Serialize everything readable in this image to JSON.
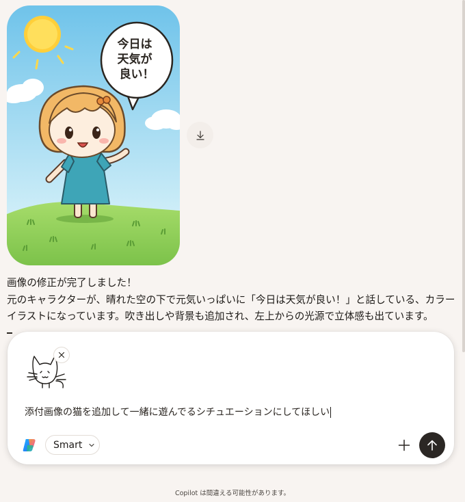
{
  "image": {
    "speech_bubble_lines": [
      "今日は",
      "天気が",
      "良い！"
    ],
    "alt": "晴れた空の下で元気いっぱいのキャラクター"
  },
  "icons": {
    "download": "download-icon",
    "close": "close-icon",
    "chevron": "chevron-down-icon",
    "plus": "plus-icon",
    "send": "arrow-up-icon",
    "logo": "copilot-logo-icon"
  },
  "reply": {
    "line1": "画像の修正が完了しました！",
    "line2": "元のキャラクターが、晴れた空の下で元気いっぱいに「今日は天気が良い！」と話している、カラーイラストになっています。吹き出しや背景も追加され、左上からの光源で立体感も出ています。"
  },
  "composer": {
    "prompt_text": "添付画像の猫を追加して一緒に遊んでるシチュエーションにしてほしい",
    "mode_label": "Smart"
  },
  "footer": {
    "disclaimer": "Copilot は間違える可能性があります。"
  },
  "colors": {
    "send_button": "#2b2724",
    "background": "#f8f4f1",
    "sky_top": "#6fc3ea",
    "grass": "#8fcf5a"
  }
}
